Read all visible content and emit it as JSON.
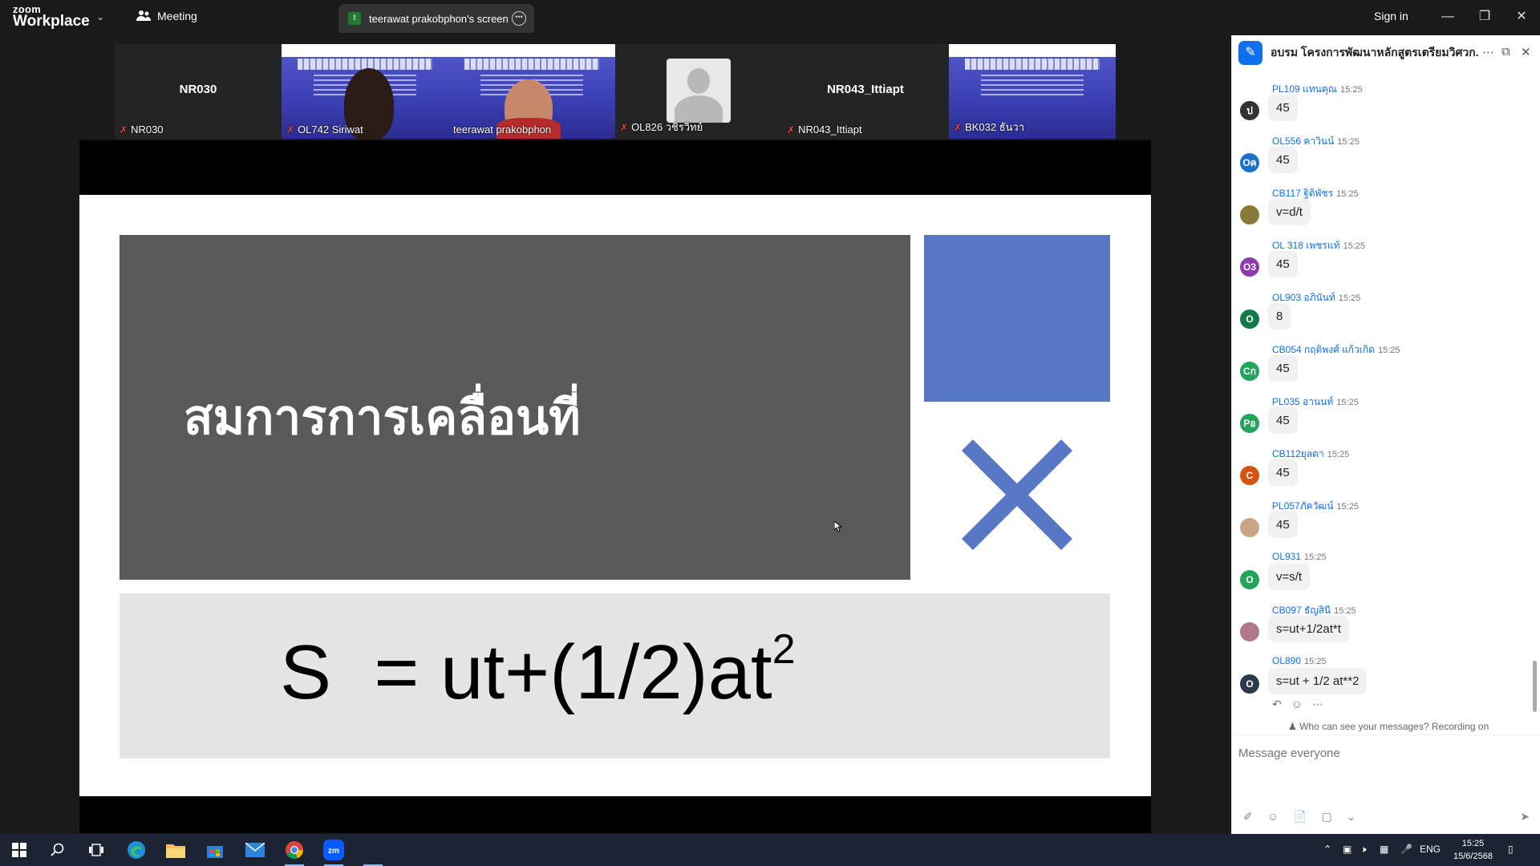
{
  "titlebar": {
    "logo_small": "zoom",
    "logo_big": "Workplace",
    "meeting_label": "Meeting",
    "share_tab_label": "teerawat prakobphon's screen",
    "share_tab_avatar": "t",
    "signin_label": "Sign in"
  },
  "gallery": [
    {
      "center_name": "NR030",
      "label": "NR030",
      "type": "name"
    },
    {
      "center_name": "",
      "label": "OL742 Siriwat",
      "type": "video"
    },
    {
      "center_name": "",
      "label": "teerawat prakobphon",
      "type": "video",
      "active": true
    },
    {
      "center_name": "",
      "label": "OL826 วชิรวิทย์",
      "type": "avatar"
    },
    {
      "center_name": "NR043_Ittiapt",
      "label": "NR043_Ittiapt",
      "type": "name"
    },
    {
      "center_name": "",
      "label": "BK032 ธันวา",
      "type": "slide"
    }
  ],
  "slide": {
    "title": "สมการการเคลื่อนที่",
    "formula": "S  = ut+(1/2)at",
    "formula_exp": "2",
    "accent_color": "#5877c4"
  },
  "chat": {
    "title": "อบรม โครงการพัฒนาหลักสูตรเตรียมวิศวก...",
    "messages": [
      {
        "sender": "PL109 แทนคุณ",
        "time": "15:25",
        "text": "45",
        "avatar": "ป",
        "avatar_color": "#333333"
      },
      {
        "sender": "OL556 คาวินน์",
        "time": "15:25",
        "text": "45",
        "avatar": "Oค",
        "avatar_color": "#1a73c9"
      },
      {
        "sender": "CB117 ฐิติพัชร",
        "time": "15:25",
        "text": "v=d/t",
        "avatar": "",
        "avatar_color": "#8a7a3a"
      },
      {
        "sender": "OL 318 เพชรแท้",
        "time": "15:25",
        "text": "45",
        "avatar": "O3",
        "avatar_color": "#8e3bb0"
      },
      {
        "sender": "OL903 อภินันท์",
        "time": "15:25",
        "text": "8",
        "avatar": "O",
        "avatar_color": "#137a4b"
      },
      {
        "sender": "CB054 กฤติพงศ์ แก้วเกิด",
        "time": "15:25",
        "text": "45",
        "avatar": "Cก",
        "avatar_color": "#23a35b"
      },
      {
        "sender": "PL035 อานนท์",
        "time": "15:25",
        "text": "45",
        "avatar": "Pอ",
        "avatar_color": "#23a35b"
      },
      {
        "sender": "CB112ยุลดา",
        "time": "15:25",
        "text": "45",
        "avatar": "C",
        "avatar_color": "#d4540f"
      },
      {
        "sender": "PL057ภัควัฒน์",
        "time": "15:25",
        "text": "45",
        "avatar": "",
        "avatar_color": "#c9a58a"
      },
      {
        "sender": "OL931",
        "time": "15:25",
        "text": "v=s/t",
        "avatar": "O",
        "avatar_color": "#23a35b"
      },
      {
        "sender": "CB097  ธัญสินี",
        "time": "15:25",
        "text": "s=ut+1/2at*t",
        "avatar": "",
        "avatar_color": "#b07a8a"
      },
      {
        "sender": "OL890",
        "time": "15:25",
        "text": "s=ut + 1/2 at**2",
        "avatar": "O",
        "avatar_color": "#2d3a4a"
      }
    ],
    "privacy_text": "Who can see your messages? Recording on",
    "input_placeholder": "Message everyone"
  },
  "taskbar": {
    "lang": "ENG",
    "time": "15:25",
    "date": "15/6/2568"
  }
}
